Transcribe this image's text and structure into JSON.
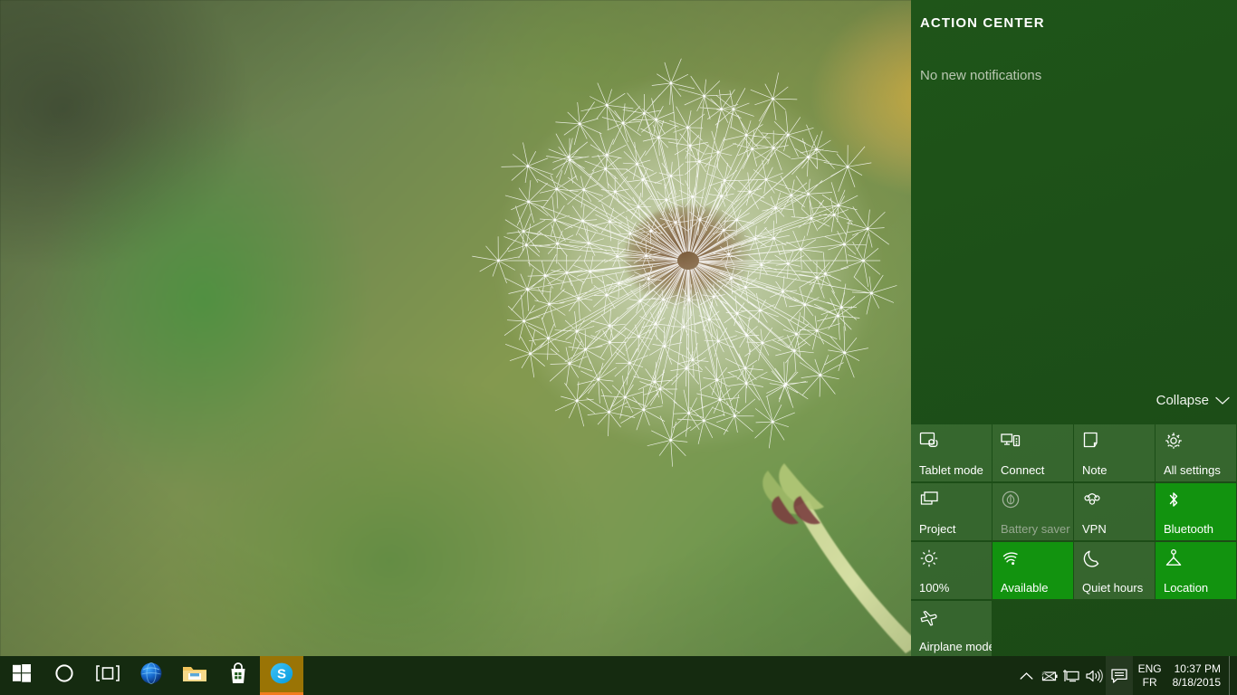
{
  "action_center": {
    "title": "ACTION CENTER",
    "empty_message": "No new notifications",
    "collapse_label": "Collapse",
    "collapse_icon": "chevron-down-icon",
    "colors": {
      "panel_bg": "#1d5018",
      "tile_inactive": "#527a4a",
      "tile_active": "#12930f",
      "text": "#ffffff",
      "text_dim": "#b9c7b2"
    },
    "tiles": [
      {
        "label": "Tablet mode",
        "icon": "tablet-mode-icon",
        "state": "inactive"
      },
      {
        "label": "Connect",
        "icon": "connect-icon",
        "state": "inactive"
      },
      {
        "label": "Note",
        "icon": "note-icon",
        "state": "inactive"
      },
      {
        "label": "All settings",
        "icon": "gear-icon",
        "state": "inactive"
      },
      {
        "label": "Project",
        "icon": "project-icon",
        "state": "inactive"
      },
      {
        "label": "Battery saver",
        "icon": "battery-saver-icon",
        "state": "disabled"
      },
      {
        "label": "VPN",
        "icon": "vpn-icon",
        "state": "inactive"
      },
      {
        "label": "Bluetooth",
        "icon": "bluetooth-icon",
        "state": "active"
      },
      {
        "label": "100%",
        "icon": "brightness-icon",
        "state": "inactive"
      },
      {
        "label": "Available",
        "icon": "wifi-icon",
        "state": "active"
      },
      {
        "label": "Quiet hours",
        "icon": "moon-icon",
        "state": "inactive"
      },
      {
        "label": "Location",
        "icon": "location-icon",
        "state": "active"
      },
      {
        "label": "Airplane mode",
        "icon": "airplane-icon",
        "state": "inactive"
      }
    ]
  },
  "taskbar": {
    "start": {
      "name": "start-button",
      "icon": "windows-logo-icon"
    },
    "apps": [
      {
        "name": "cortana-search-button",
        "icon": "cortana-circle-icon",
        "active": false
      },
      {
        "name": "task-view-button",
        "icon": "task-view-icon",
        "active": false
      },
      {
        "name": "edge-button",
        "icon": "edge-browser-icon",
        "active": false
      },
      {
        "name": "file-explorer-button",
        "icon": "folder-icon",
        "active": false
      },
      {
        "name": "store-button",
        "icon": "store-bag-icon",
        "active": false
      },
      {
        "name": "skype-button",
        "icon": "skype-icon",
        "active": true
      }
    ],
    "tray": {
      "overflow_icon": "chevron-up-icon",
      "battery_icon": "battery-charging-icon",
      "network_icon": "network-monitor-icon",
      "volume_icon": "speaker-icon",
      "action_center_icon": "speech-bubble-icon",
      "language_primary": "ENG",
      "language_secondary": "FR",
      "time": "10:37 PM",
      "date": "8/18/2015",
      "show_desktop": "show-desktop-strip"
    }
  }
}
